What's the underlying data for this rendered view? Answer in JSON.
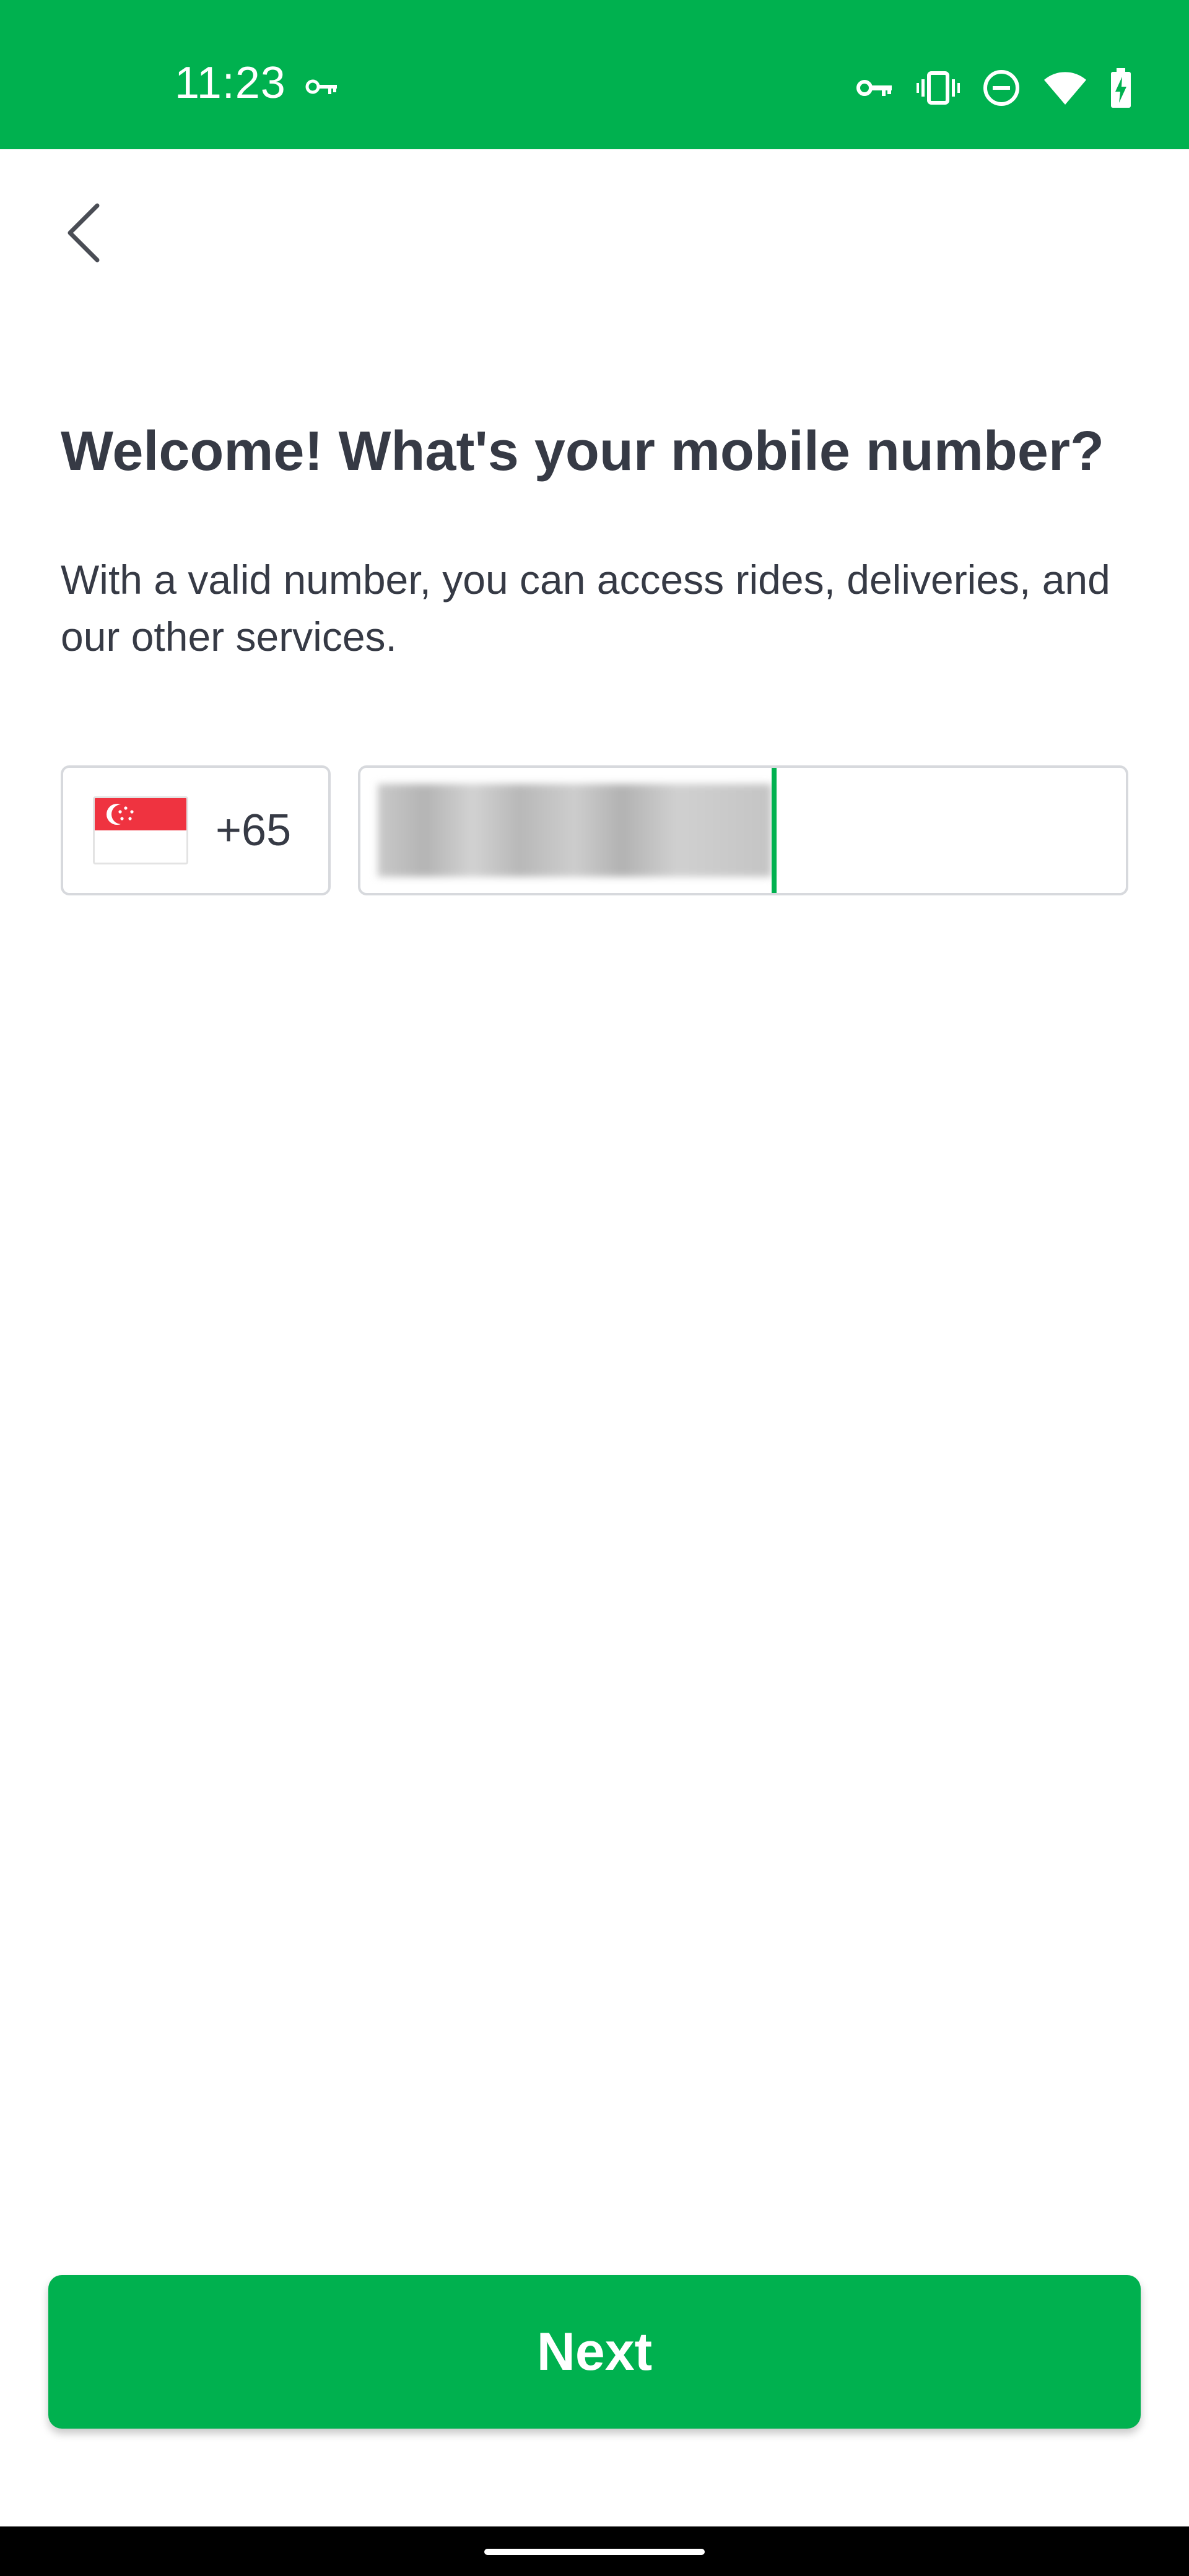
{
  "status_bar": {
    "time": "11:23",
    "background_color": "#00b14f",
    "icons": [
      "vpn-key-icon",
      "vpn-key-icon",
      "vibrate-icon",
      "do-not-disturb-icon",
      "wifi-icon",
      "battery-charging-icon"
    ]
  },
  "header": {
    "back_icon": "chevron-left-icon"
  },
  "main": {
    "title": "Welcome! What's your mobile number?",
    "subtitle": "With a valid number, you can access rides, deliveries, and our other services.",
    "country": {
      "flag": "singapore-flag-icon",
      "dial_code": "+65"
    },
    "phone_input": {
      "value_redacted": true
    }
  },
  "footer": {
    "next_label": "Next"
  },
  "colors": {
    "accent": "#00b14f",
    "text": "#363a45",
    "border": "#d7d9dd"
  }
}
